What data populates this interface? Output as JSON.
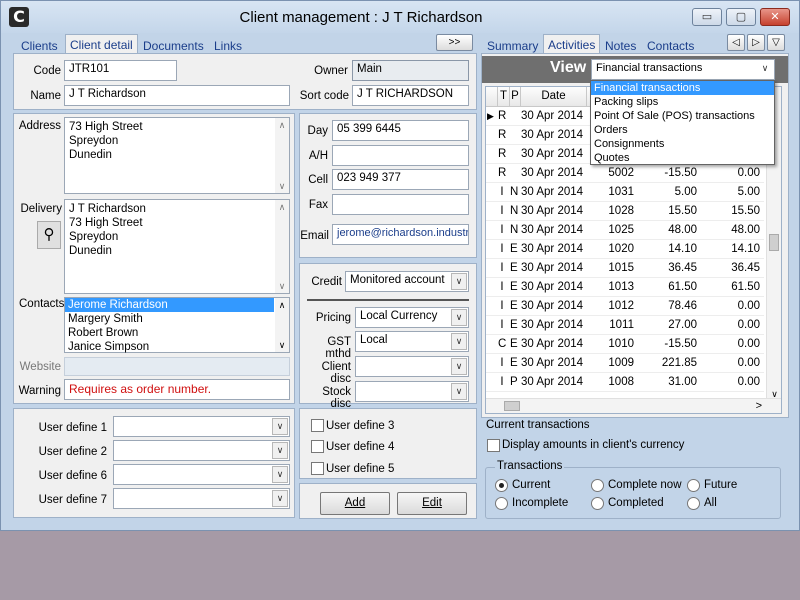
{
  "window": {
    "title": "Client management : J T Richardson",
    "app_icon_glyph": "C",
    "min_glyph": "▭",
    "max_glyph": "▢",
    "close_glyph": "✕"
  },
  "left_tabs": [
    "Clients",
    "Client detail",
    "Documents",
    "Links"
  ],
  "scroll_tabs_label": ">>",
  "right_tabs": [
    "Summary",
    "Activities",
    "Notes",
    "Contacts"
  ],
  "nav": {
    "back": "◁",
    "forward": "▷",
    "menu": "▽"
  },
  "detail": {
    "code_label": "Code",
    "code": "JTR101",
    "owner_label": "Owner",
    "owner": "Main",
    "name_label": "Name",
    "name": "J T Richardson",
    "sortcode_label": "Sort code",
    "sortcode": "J T RICHARDSON",
    "address_label": "Address",
    "address": [
      "73 High Street",
      "Spreydon",
      "Dunedin"
    ],
    "delivery_label": "Delivery",
    "delivery": [
      "J T Richardson",
      "73 High Street",
      "Spreydon",
      "Dunedin"
    ],
    "contacts_label": "Contacts",
    "contacts": [
      "Jerome Richardson",
      "Margery Smith",
      "Robert Brown",
      "Janice Simpson"
    ],
    "website_label": "Website",
    "website": "",
    "warning_label": "Warning",
    "warning": "Requires as order number.",
    "day_label": "Day",
    "day": "05 399 6445",
    "ah_label": "A/H",
    "ah": "",
    "cell_label": "Cell",
    "cell": "023 949 377",
    "fax_label": "Fax",
    "fax": "",
    "email_label": "Email",
    "email": "jerome@richardson.industr",
    "credit_label": "Credit",
    "credit": "Monitored account",
    "pricing_label": "Pricing",
    "pricing": "Local Currency",
    "gst_label": "GST mthd",
    "gst": "Local",
    "clientdisc_label": "Client disc",
    "clientdisc": "",
    "stockdisc_label": "Stock disc",
    "stockdisc": "",
    "userdefs": [
      {
        "label": "User define 1",
        "value": ""
      },
      {
        "label": "User define 2",
        "value": ""
      },
      {
        "label": "User define 6",
        "value": ""
      },
      {
        "label": "User define 7",
        "value": ""
      }
    ],
    "userchecks": [
      "User define 3",
      "User define 4",
      "User define 5"
    ],
    "add_label": "Add",
    "edit_label": "Edit"
  },
  "view": {
    "label": "View",
    "selected": "Financial transactions",
    "options": [
      "Financial transactions",
      "Packing slips",
      "Point Of Sale (POS) transactions",
      "Orders",
      "Consignments",
      "Quotes"
    ]
  },
  "grid": {
    "headers": [
      "T",
      "P",
      "Date"
    ],
    "rows": [
      {
        "t": "R",
        "p": "",
        "date": "30 Apr 2014",
        "ref": "",
        "amt": "",
        "bal": ""
      },
      {
        "t": "R",
        "p": "",
        "date": "30 Apr 2014",
        "ref": "",
        "amt": "",
        "bal": ""
      },
      {
        "t": "R",
        "p": "",
        "date": "30 Apr 2014",
        "ref": "",
        "amt": "",
        "bal": ""
      },
      {
        "t": "R",
        "p": "",
        "date": "30 Apr 2014",
        "ref": "5002",
        "amt": "-15.50",
        "bal": "0.00"
      },
      {
        "t": "I",
        "p": "N",
        "date": "30 Apr 2014",
        "ref": "1031",
        "amt": "5.00",
        "bal": "5.00"
      },
      {
        "t": "I",
        "p": "N",
        "date": "30 Apr 2014",
        "ref": "1028",
        "amt": "15.50",
        "bal": "15.50"
      },
      {
        "t": "I",
        "p": "N",
        "date": "30 Apr 2014",
        "ref": "1025",
        "amt": "48.00",
        "bal": "48.00"
      },
      {
        "t": "I",
        "p": "E",
        "date": "30 Apr 2014",
        "ref": "1020",
        "amt": "14.10",
        "bal": "14.10"
      },
      {
        "t": "I",
        "p": "E",
        "date": "30 Apr 2014",
        "ref": "1015",
        "amt": "36.45",
        "bal": "36.45"
      },
      {
        "t": "I",
        "p": "E",
        "date": "30 Apr 2014",
        "ref": "1013",
        "amt": "61.50",
        "bal": "61.50"
      },
      {
        "t": "I",
        "p": "E",
        "date": "30 Apr 2014",
        "ref": "1012",
        "amt": "78.46",
        "bal": "0.00"
      },
      {
        "t": "I",
        "p": "E",
        "date": "30 Apr 2014",
        "ref": "1011",
        "amt": "27.00",
        "bal": "0.00"
      },
      {
        "t": "C",
        "p": "E",
        "date": "30 Apr 2014",
        "ref": "1010",
        "amt": "-15.50",
        "bal": "0.00"
      },
      {
        "t": "I",
        "p": "E",
        "date": "30 Apr 2014",
        "ref": "1009",
        "amt": "221.85",
        "bal": "0.00"
      },
      {
        "t": "I",
        "p": "P",
        "date": "30 Apr 2014",
        "ref": "1008",
        "amt": "31.00",
        "bal": "0.00"
      }
    ],
    "hscroll_glyph": ">",
    "vscroll_down": "∨",
    "row_pointer": "▶"
  },
  "current_transactions_label": "Current transactions",
  "display_amounts_label": "Display amounts in client's currency",
  "transactions": {
    "group_label": "Transactions",
    "options": [
      "Current",
      "Complete now",
      "Future",
      "Incomplete",
      "Completed",
      "All"
    ],
    "selected": "Current"
  },
  "glyphs": {
    "combo_arrow": "∨",
    "up": "∧",
    "down": "∨",
    "delivery_icon": "⚲"
  }
}
